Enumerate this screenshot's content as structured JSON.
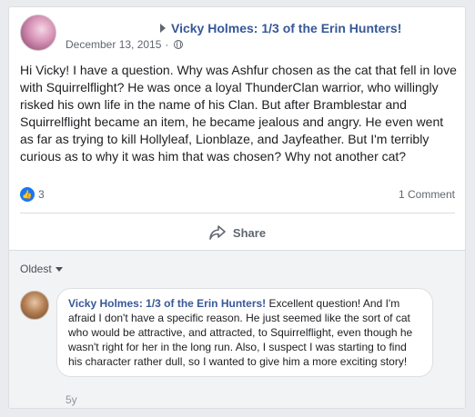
{
  "post": {
    "author": "Vicky Holmes: 1/3 of the Erin Hunters!",
    "date": "December 13, 2015",
    "dot": "·",
    "privacy_icon": "globe-icon",
    "text": "Hi Vicky! I have a question. Why was Ashfur chosen as the cat that fell in love with Squirrelflight? He was once a loyal ThunderClan warrior, who willingly risked his own life in the name of his Clan. But after Bramblestar and Squirrelflight became an item, he became jealous and angry. He even went as far as trying to kill Hollyleaf, Lionblaze, and Jayfeather. But I'm terribly curious as to why it was him that was chosen? Why not another cat?"
  },
  "reactions": {
    "like_count": "3",
    "comment_count": "1 Comment"
  },
  "actions": {
    "share_label": "Share"
  },
  "comments": {
    "sort_label": "Oldest",
    "items": [
      {
        "author": "Vicky Holmes: 1/3 of the Erin Hunters!",
        "text": "Excellent question! And I'm afraid I don't have a specific reason. He just seemed like the sort of cat who would be attractive, and attracted, to Squirrelflight, even though he wasn't right for her in the long run. Also, I suspect I was starting to find his character rather dull, so I wanted to give him a more exciting story!",
        "age": "5y"
      }
    ]
  },
  "colors": {
    "link": "#365899",
    "like": "#1877f2",
    "page_bg": "#e9ebee"
  }
}
